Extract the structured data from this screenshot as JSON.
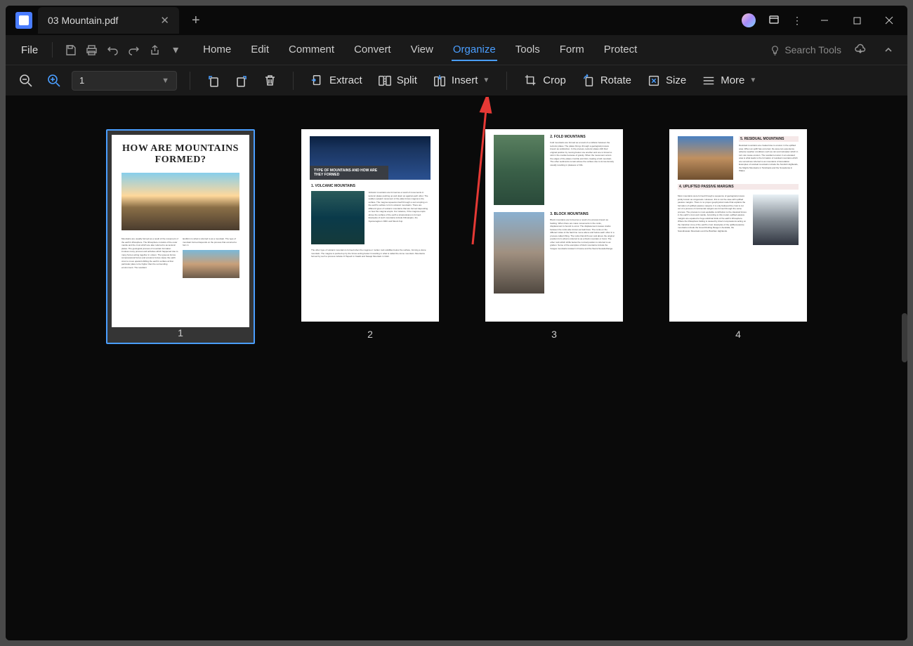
{
  "tab": {
    "title": "03 Mountain.pdf"
  },
  "menu": {
    "file": "File",
    "tabs": [
      "Home",
      "Edit",
      "Comment",
      "Convert",
      "View",
      "Organize",
      "Tools",
      "Form",
      "Protect"
    ],
    "active": "Organize",
    "search_placeholder": "Search Tools"
  },
  "toolbar": {
    "page_value": "1",
    "extract": "Extract",
    "split": "Split",
    "insert": "Insert",
    "crop": "Crop",
    "rotate": "Rotate",
    "size": "Size",
    "more": "More"
  },
  "thumbnails": {
    "labels": [
      "1",
      "2",
      "3",
      "4"
    ],
    "page1": {
      "title": "HOW ARE MOUNTAINS FORMED?"
    },
    "page2": {
      "overlay": "TYPE OF MOUNTAINS AND HOW ARE THEY FORMED",
      "sub": "1. VOLCANIC MOUNTAINS"
    },
    "page3": {
      "h1": "2. FOLD MOUNTAINS",
      "h2": "3. BLOCK MOUNTAINS"
    },
    "page4": {
      "h1": "4. UPLIFTED PASSIVE MARGINS",
      "h2": "5. RESIDUAL MOUNTAINS"
    }
  }
}
